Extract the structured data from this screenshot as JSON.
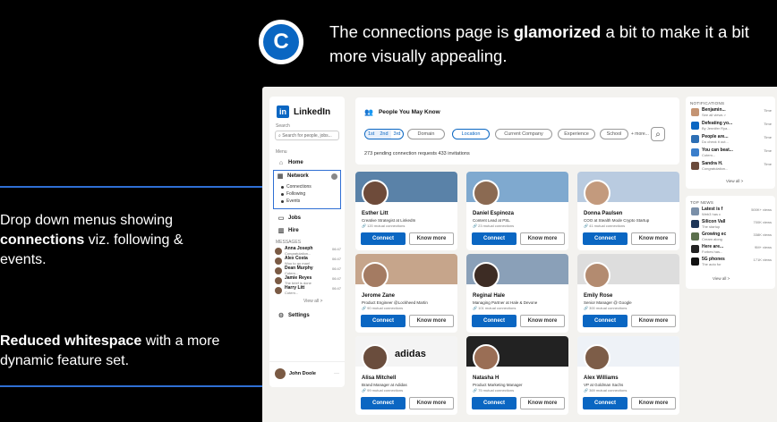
{
  "callout": {
    "badge_letter": "C",
    "headline_pre": "The connections page is ",
    "headline_bold": "glamorized",
    "headline_post": " a bit to make it a bit more visually appealing.",
    "note1_pre": "Drop down menus showing ",
    "note1_bold": "connections",
    "note1_post": " viz. following & events.",
    "note2_bold": "Reduced whitespace",
    "note2_post": " with a more dynamic feature set."
  },
  "sidebar": {
    "brand": "LinkedIn",
    "search_label": "Search",
    "search_placeholder": "Search for people, jobs...",
    "menu_label": "Menu",
    "home": "Home",
    "network": "Network",
    "network_subs": [
      "Connections",
      "Following",
      "Events"
    ],
    "jobs": "Jobs",
    "hire": "Hire",
    "messages_label": "MESSAGES",
    "messages": [
      {
        "name": "Anna Joseph",
        "preview": "Congratulation...",
        "time": "06:47"
      },
      {
        "name": "Alex Costa",
        "preview": "Woo to go man!",
        "time": "06:47"
      },
      {
        "name": "Dean Murphy",
        "preview": "Cotem...",
        "time": "06:47"
      },
      {
        "name": "Jamie Reyes",
        "preview": "The brief is done",
        "time": "06:47"
      },
      {
        "name": "Harry Litt",
        "preview": "Cotem...",
        "time": "06:47"
      }
    ],
    "view_all": "View all >",
    "settings": "Settings",
    "user": "John Doole",
    "user_more": "···"
  },
  "main": {
    "title": "People You May Know",
    "degree_tabs": [
      "1st",
      "2nd",
      "3rd"
    ],
    "filters": [
      "Domain",
      "Location",
      "Current Company",
      "Experience",
      "School"
    ],
    "more": "+ more...",
    "pending": "273 pending connection requests  433 invitations",
    "connect_label": "Connect",
    "know_more_label": "Know more",
    "cards": [
      {
        "name": "Esther Litt",
        "title": "Creative Strategist at LinkedIn",
        "mutual": "120 mutual connections"
      },
      {
        "name": "Daniel Espinoza",
        "title": "Content Lead at PSL",
        "mutual": "23 mutual connections"
      },
      {
        "name": "Donna Paulsen",
        "title": "COO at Stealth Mode Crypto Startup",
        "mutual": "41 mutual connections"
      },
      {
        "name": "Jerome Zane",
        "title": "Product Engineer @Lockheed Martin",
        "mutual": "90 mutual connections"
      },
      {
        "name": "Reginal Hale",
        "title": "Managing Partner at Hale & Devone",
        "mutual": "101 mutual connections"
      },
      {
        "name": "Emily Rose",
        "title": "Senior Manager @ Google",
        "mutual": "300 mutual connections"
      },
      {
        "name": "Alisa Mitchell",
        "title": "Brand Manager at Adidas",
        "mutual": "99 mutual connections"
      },
      {
        "name": "Natasha H",
        "title": "Product Marketing Manager",
        "mutual": "75 mutual connections"
      },
      {
        "name": "Alex Williams",
        "title": "VP at Goldman Sachs",
        "mutual": "369 mutual connections"
      }
    ],
    "adidas": "adidas"
  },
  "notifications": {
    "header": "NOTIFICATIONS",
    "items": [
      {
        "title": "Benjamin...",
        "sub": "See all views >",
        "time": "Time"
      },
      {
        "title": "Defeating yo...",
        "sub": "By Jennifer Rya...",
        "time": "Time"
      },
      {
        "title": "People are...",
        "sub": "Do check it out...",
        "time": "Time"
      },
      {
        "title": "You can beat...",
        "sub": "Cotem...",
        "time": "Time"
      },
      {
        "title": "Sandra H.",
        "sub": "Congratulation...",
        "time": "Time"
      }
    ],
    "view_all": "View all >"
  },
  "news": {
    "header": "TOP NEWS",
    "items": [
      {
        "title": "Latest is f",
        "sub": "Web3 has c",
        "views": "500K+ views"
      },
      {
        "title": "Silicon Vall",
        "sub": "The startup",
        "views": "700K views"
      },
      {
        "title": "Growing ec",
        "sub": "Cream along",
        "views": "338K views"
      },
      {
        "title": "Here are...",
        "sub": "Forbes has...",
        "views": "9M+ views"
      },
      {
        "title": "5G phones",
        "sub": "The auto for",
        "views": "171K views"
      }
    ],
    "view_all": "View all >"
  },
  "colors": {
    "accent": "#0a66c2",
    "callout_line": "#2f6fd4"
  }
}
